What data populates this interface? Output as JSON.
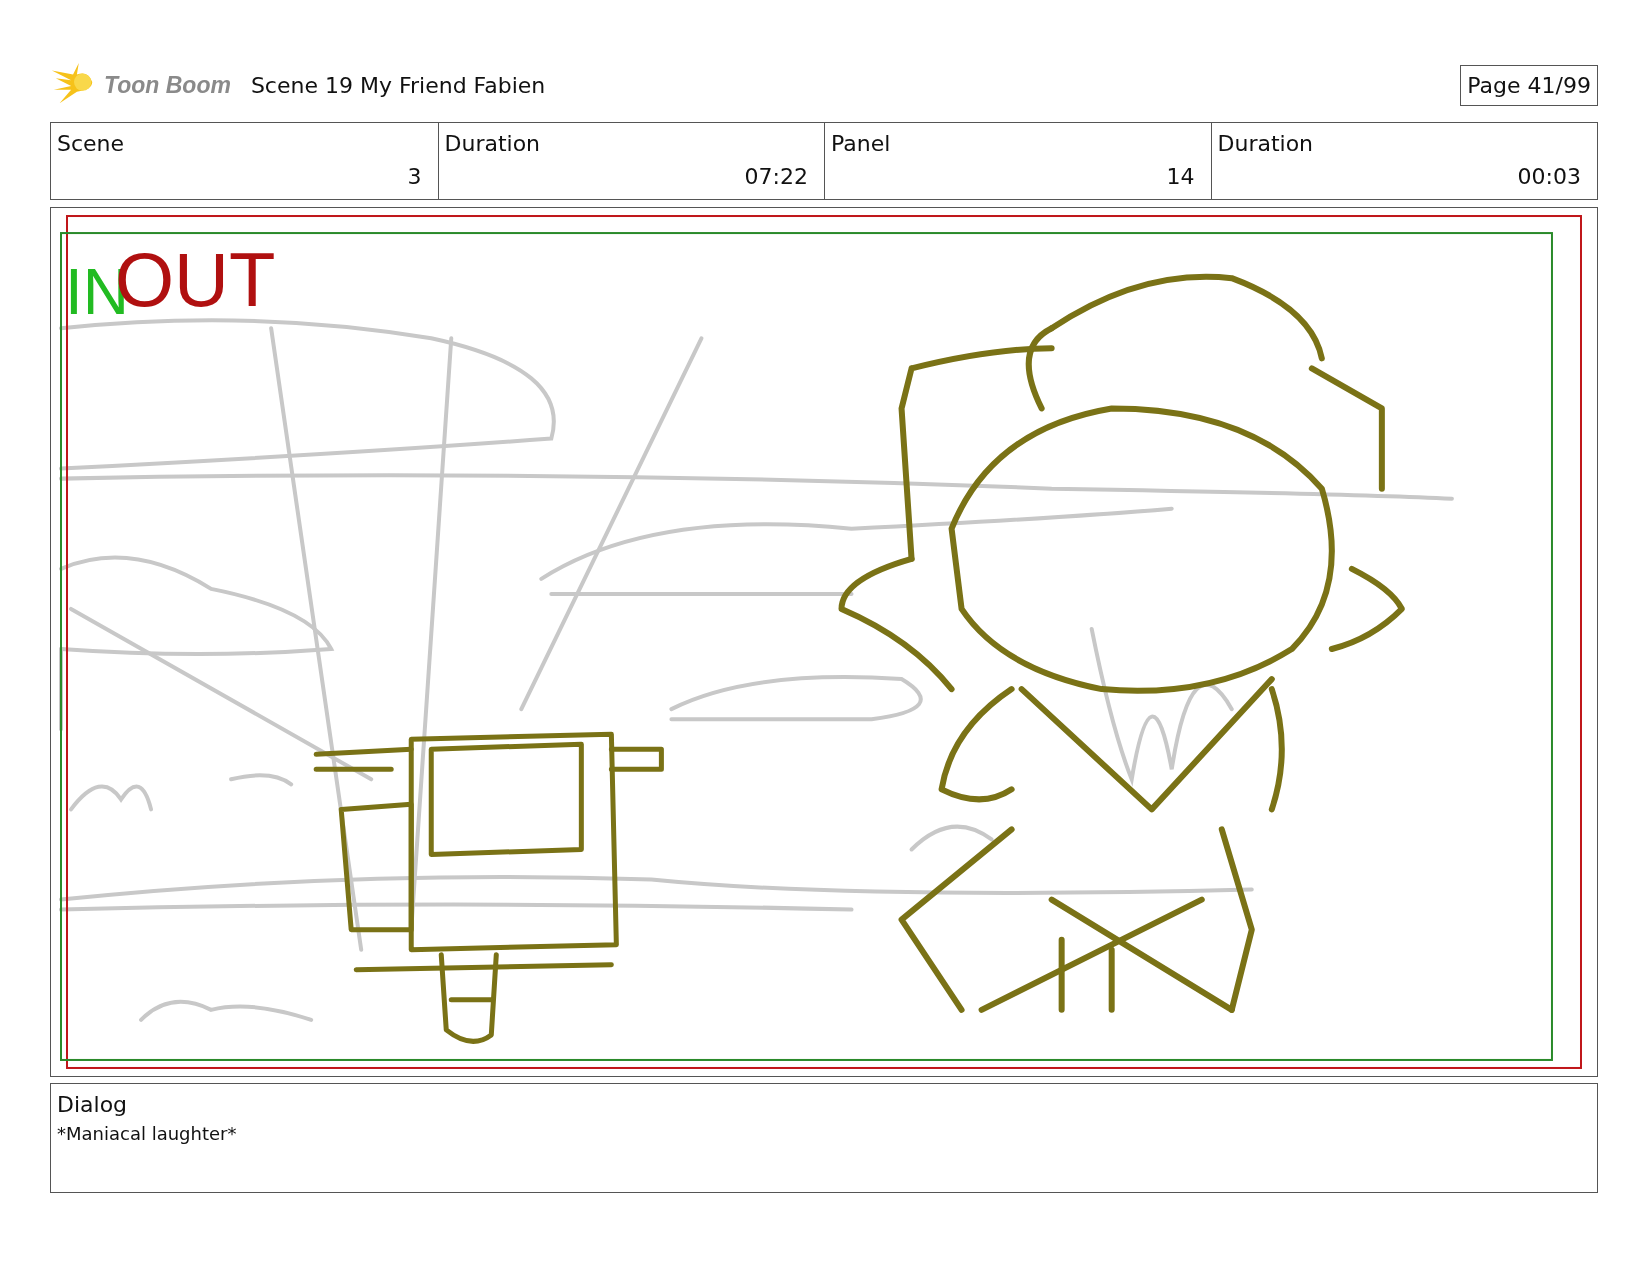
{
  "header": {
    "logo_text": "Toon Boom",
    "title": "Scene 19 My Friend Fabien",
    "page": "Page 41/99"
  },
  "info": [
    {
      "label": "Scene",
      "value": "3"
    },
    {
      "label": "Duration",
      "value": "07:22"
    },
    {
      "label": "Panel",
      "value": "14"
    },
    {
      "label": "Duration",
      "value": "00:03"
    }
  ],
  "panel": {
    "in_label": "IN",
    "out_label": "OUT"
  },
  "dialog": {
    "label": "Dialog",
    "text": "*Maniacal laughter*"
  }
}
